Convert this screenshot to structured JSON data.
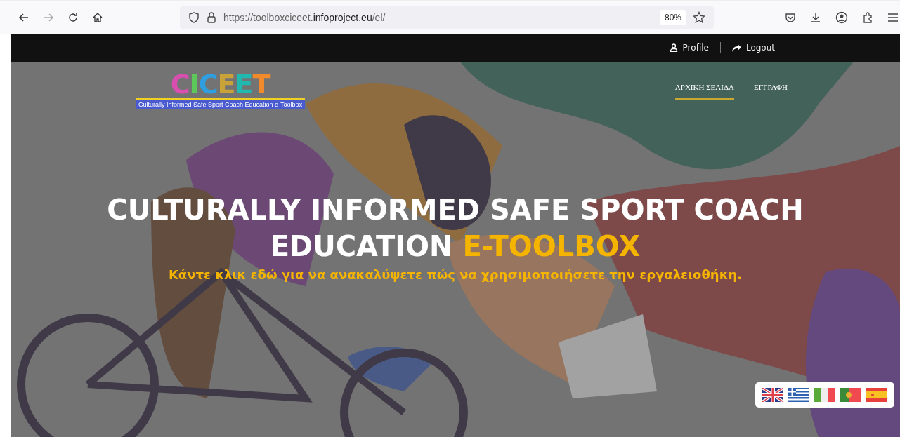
{
  "browser": {
    "url_prefix": "https://toolboxciceet.",
    "url_domain": "infoproject.eu",
    "url_suffix": "/el/",
    "zoom": "80%"
  },
  "top_bar": {
    "links": [
      {
        "kind": "profile",
        "label": "Profile"
      },
      {
        "kind": "logout",
        "label": "Logout"
      }
    ]
  },
  "logo": {
    "letters": [
      {
        "char": "C",
        "color": "#d94fb0"
      },
      {
        "char": "I",
        "color": "#5cc85a"
      },
      {
        "char": "C",
        "color": "#2f9fe0"
      },
      {
        "char": "E",
        "color": "#c9a23a"
      },
      {
        "char": "E",
        "color": "#21b8b0"
      },
      {
        "char": "T",
        "color": "#f08a2a"
      }
    ],
    "tagline": "Culturally Informed Safe Sport Coach Education e-Toolbox"
  },
  "nav": [
    {
      "label": "ΑΡΧΙΚΗ ΣΕΛΙΔΑ",
      "selected": true
    },
    {
      "label": "ΕΓΓΡΑΦΗ",
      "selected": false
    }
  ],
  "hero": {
    "title": "CULTURALLY INFORMED SAFE SPORT COACH EDUCATION",
    "title_highlight": "E-TOOLBOX",
    "subtitle": "Κάντε κλικ εδώ για να ανακαλύψετε πώς να χρησιμοποιήσετε την εργαλειοθήκη."
  },
  "languages": [
    {
      "kind": "uk"
    },
    {
      "kind": "gr"
    },
    {
      "kind": "it"
    },
    {
      "kind": "pt"
    },
    {
      "kind": "es"
    }
  ]
}
